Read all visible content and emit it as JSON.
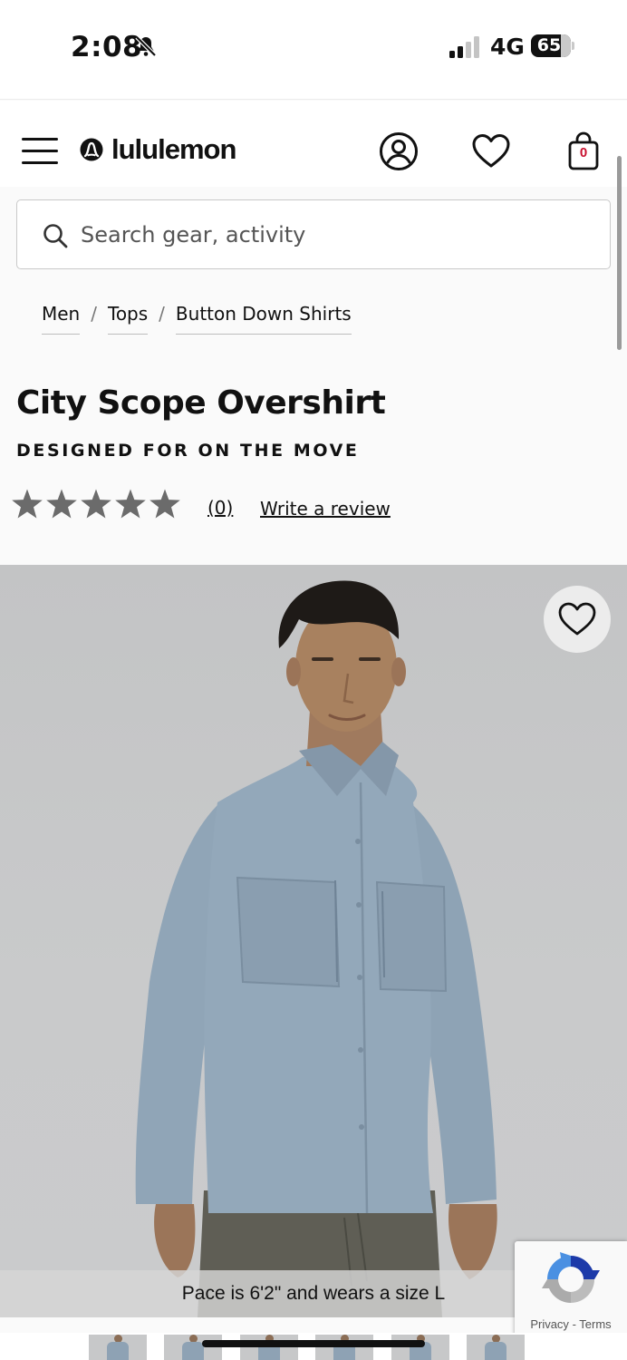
{
  "status_bar": {
    "time": "2:08",
    "network": "4G",
    "battery": "65"
  },
  "header": {
    "brand": "lululemon",
    "bag_count": "0"
  },
  "search": {
    "placeholder": "Search gear, activity"
  },
  "breadcrumb": [
    {
      "label": "Men"
    },
    {
      "label": "Tops"
    },
    {
      "label": "Button Down Shirts"
    }
  ],
  "product": {
    "title": "City Scope Overshirt",
    "tagline": "DESIGNED FOR ON THE MOVE",
    "rating": 5,
    "review_count": "(0)",
    "write_review": "Write a review",
    "model_caption": "Pace is 6'2\" and wears a size L"
  },
  "recaptcha": {
    "privacy": "Privacy",
    "separator": "-",
    "terms": "Terms"
  },
  "colors": {
    "star": "#6b6b6b",
    "bag_count": "#c8102e",
    "shirt": "#93a8ba"
  },
  "icons": [
    "bell-off-icon",
    "signal-icon",
    "battery-icon",
    "menu-icon",
    "lululemon-logo-icon",
    "account-icon",
    "heart-icon",
    "bag-icon",
    "search-icon",
    "star-icon",
    "recaptcha-icon"
  ]
}
